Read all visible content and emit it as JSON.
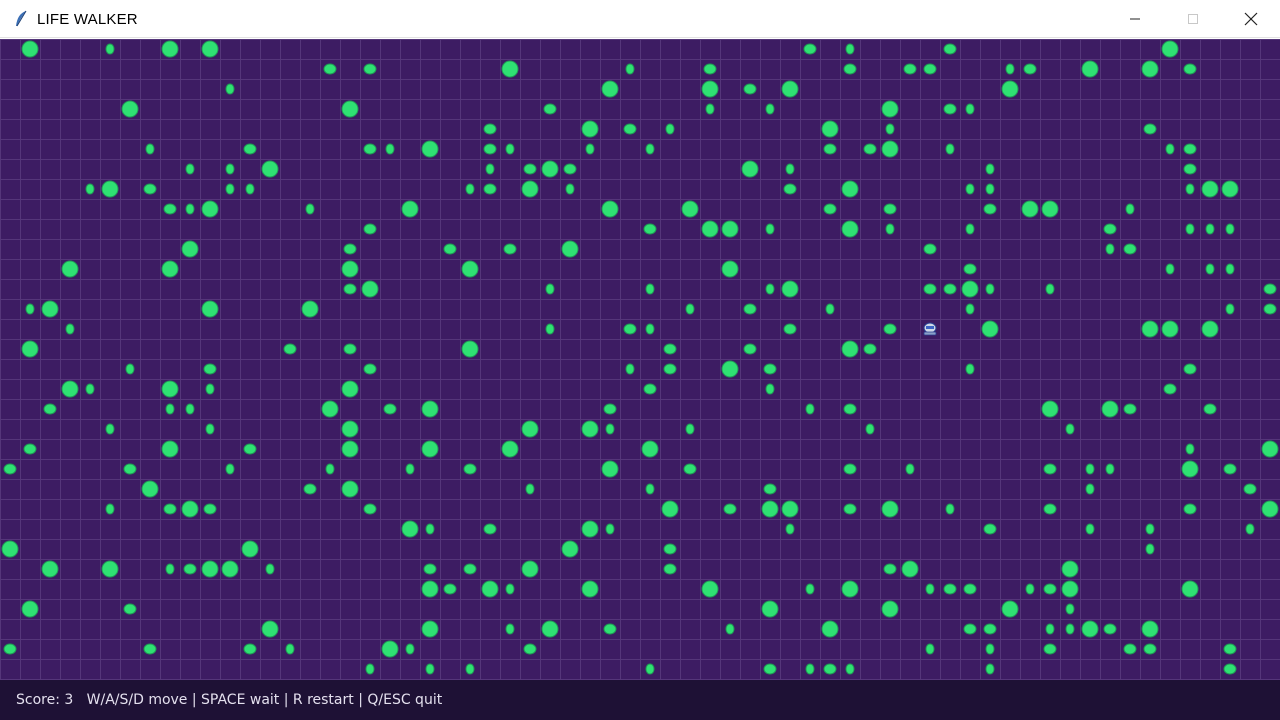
{
  "window": {
    "title": "LIFE WALKER",
    "icon": "feather-icon",
    "controls": [
      "minimize-icon",
      "maximize-icon",
      "close-icon"
    ]
  },
  "board": {
    "background": "#3d1c63",
    "grid_color": "#55367a",
    "cell_color": "#2fe173",
    "cell_outline": "#1f9e55",
    "player_icon": "robot-icon",
    "player_cell": [
      46,
      14
    ],
    "pattern_seed": 20240613
  },
  "status": {
    "text": "Score: 3   W/A/S/D move | SPACE wait | R restart | Q/ESC quit"
  }
}
